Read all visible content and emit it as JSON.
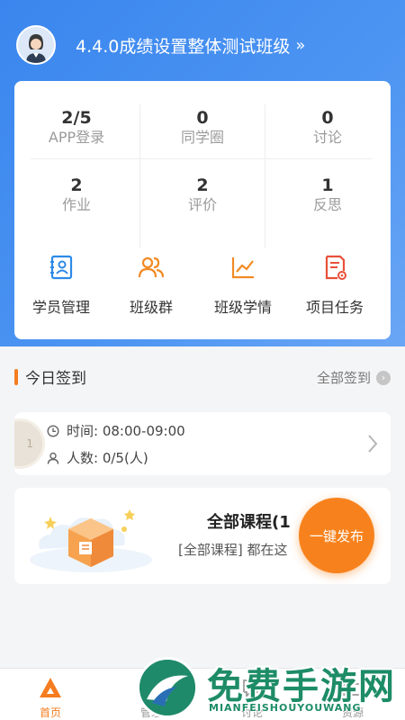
{
  "header": {
    "class_title": "4.4.0成绩设置整体测试班级",
    "arrow": "»"
  },
  "stats": [
    {
      "num": "2/5",
      "label": "APP登录"
    },
    {
      "num": "0",
      "label": "同学圈"
    },
    {
      "num": "0",
      "label": "讨论"
    },
    {
      "num": "2",
      "label": "作业"
    },
    {
      "num": "2",
      "label": "评价"
    },
    {
      "num": "1",
      "label": "反思"
    }
  ],
  "features": [
    {
      "label": "学员管理",
      "icon": "student-card-icon"
    },
    {
      "label": "班级群",
      "icon": "people-icon"
    },
    {
      "label": "班级学情",
      "icon": "trend-chart-icon"
    },
    {
      "label": "项目任务",
      "icon": "task-doc-icon"
    }
  ],
  "checkin": {
    "section_title": "今日签到",
    "all_link": "全部签到",
    "badge": "1",
    "time": "时间: 08:00-09:00",
    "people": "人数: 0/5(人)"
  },
  "course": {
    "title": "全部课程(1",
    "subtitle": "[全部课程] 都在这"
  },
  "fab": {
    "label": "一键发布"
  },
  "tabs": [
    {
      "label": "首页",
      "active": true
    },
    {
      "label": "管理",
      "active": false
    },
    {
      "label": "讨论",
      "active": false
    },
    {
      "label": "资源",
      "active": false
    }
  ],
  "watermark": {
    "title": "免费手游网",
    "sub": "MIANFEISHOUYOUWANG"
  },
  "colors": {
    "primary": "#3a86ee",
    "accent": "#f57c1f",
    "tab_active": "#f57c1f"
  }
}
